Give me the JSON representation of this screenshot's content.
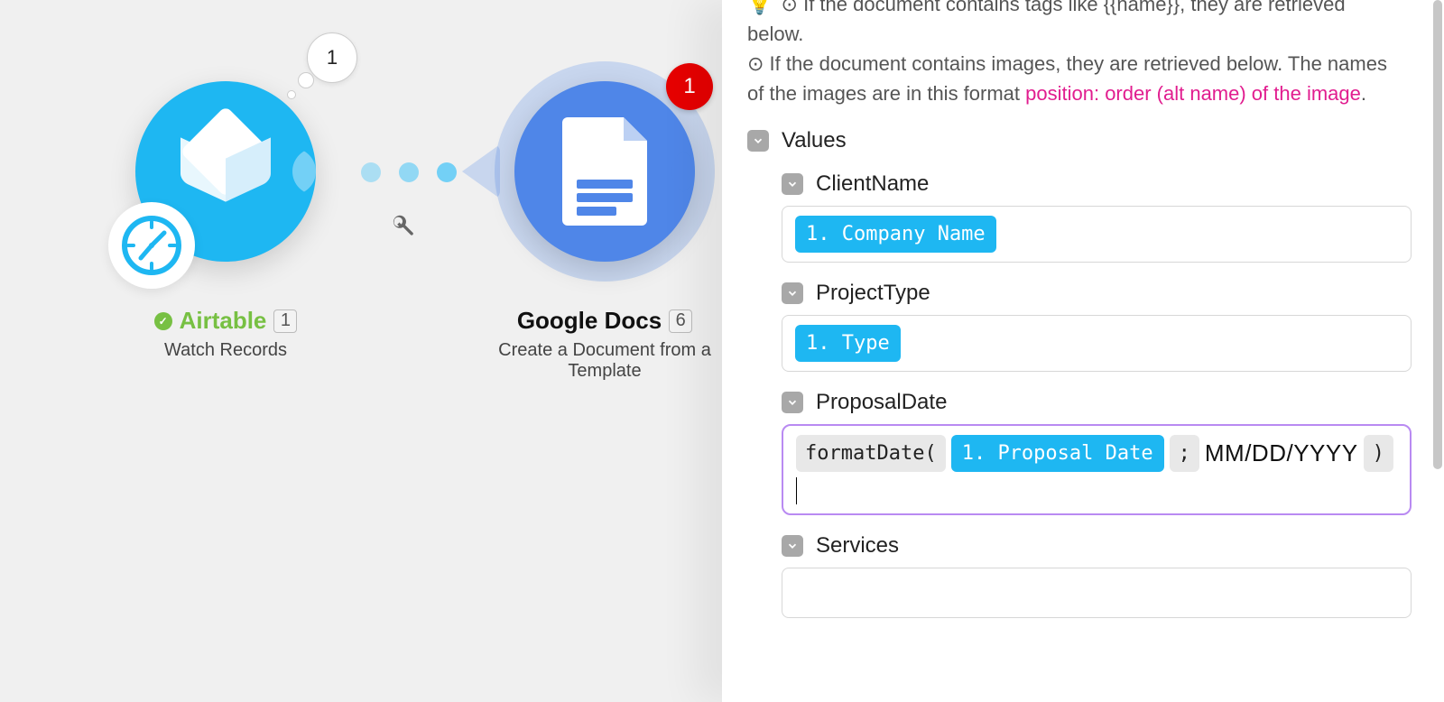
{
  "canvas": {
    "airtable": {
      "title": "Airtable",
      "index": "1",
      "subtitle": "Watch Records",
      "bundle_count": "1"
    },
    "gdocs": {
      "title": "Google Docs",
      "index": "6",
      "subtitle": "Create a Document from a Template",
      "notification_count": "1"
    }
  },
  "panel": {
    "info_line1_prefix": "⊙ If the document contains tags like {{name}}, they are retrieved below.",
    "info_line2": "⊙ If the document contains images, they are retrieved below. The names of the images are in this format ",
    "info_pink": "position: order (alt name) of the image",
    "section_values": "Values",
    "fields": {
      "client_name": {
        "label": "ClientName",
        "pill": "1. Company Name"
      },
      "project_type": {
        "label": "ProjectType",
        "pill": "1. Type"
      },
      "proposal_date": {
        "label": "ProposalDate",
        "fn_open": "formatDate(",
        "pill": "1. Proposal Date",
        "sep": ";",
        "raw": "MM/DD/YYYY",
        "fn_close": ")"
      },
      "services": {
        "label": "Services"
      }
    }
  }
}
